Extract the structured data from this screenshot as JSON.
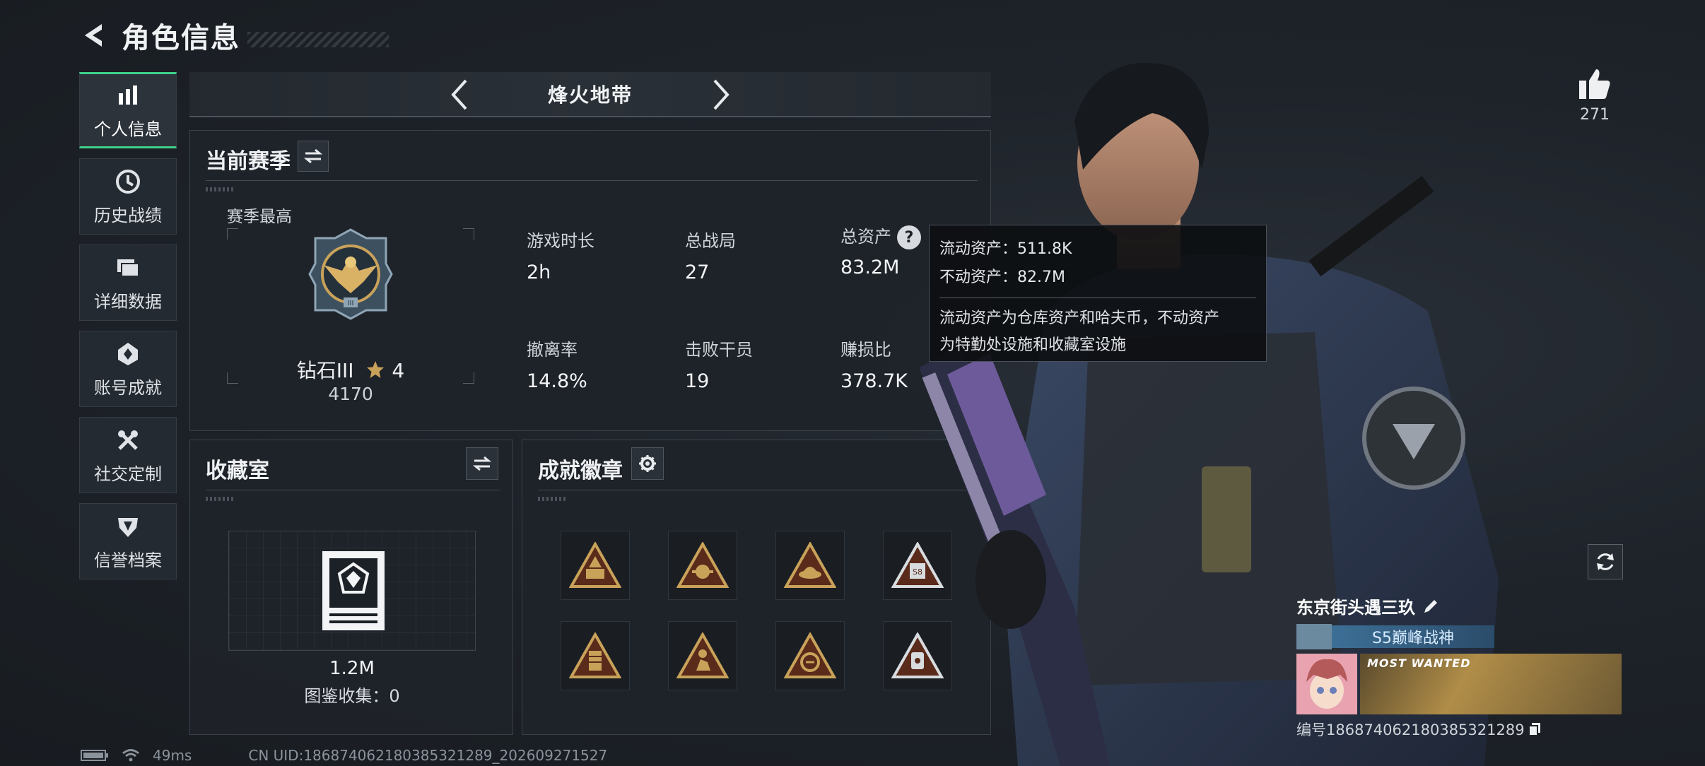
{
  "header": {
    "title": "角色信息"
  },
  "sidebar": {
    "items": [
      {
        "label": "个人信息",
        "icon": "bar-chart-icon",
        "active": true
      },
      {
        "label": "历史战绩",
        "icon": "clock-icon"
      },
      {
        "label": "详细数据",
        "icon": "folder-icon"
      },
      {
        "label": "账号成就",
        "icon": "achievement-icon"
      },
      {
        "label": "社交定制",
        "icon": "tools-icon"
      },
      {
        "label": "信誉档案",
        "icon": "shield-icon"
      }
    ]
  },
  "mode": {
    "title": "烽火地带"
  },
  "season": {
    "title": "当前赛季",
    "best_label": "赛季最高",
    "rank_name": "钻石III",
    "rank_stars": "4",
    "rank_score": "4170",
    "stats": [
      {
        "label": "游戏时长",
        "value": "2h"
      },
      {
        "label": "总战局",
        "value": "27"
      },
      {
        "label": "总资产",
        "value": "83.2M"
      },
      {
        "label": "撤离率",
        "value": "14.8%"
      },
      {
        "label": "击败干员",
        "value": "19"
      },
      {
        "label": "赚损比",
        "value": "378.7K"
      }
    ]
  },
  "tooltip": {
    "liquid": "流动资产：511.8K",
    "fixed": "不动资产：82.7M",
    "desc_line1": "流动资产为仓库资产和哈夫币，不动资产",
    "desc_line2": "为特勤处设施和收藏室设施"
  },
  "collection": {
    "title": "收藏室",
    "value": "1.2M",
    "collect_label": "图鉴收集：0"
  },
  "achievements": {
    "title": "成就徽章"
  },
  "likes": {
    "count": "271"
  },
  "player": {
    "name": "东京街头遇三玖",
    "title": "S5巅峰战神",
    "banner_text": "MOST WANTED",
    "id": "编号1868740621803853212​89"
  },
  "status": {
    "ping": "49ms",
    "uid": "CN UID:1868740621803853212​89_202609271527"
  },
  "colors": {
    "accent": "#3fd08a",
    "gold": "#c9a25a",
    "badge_red": "#5a2a1a"
  }
}
